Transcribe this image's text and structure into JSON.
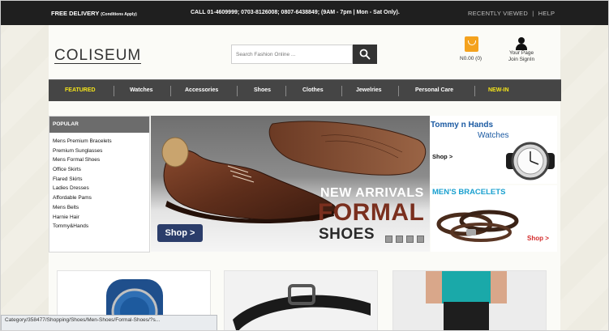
{
  "topbar": {
    "delivery": "FREE DELIVERY",
    "conditions": "(Conditions Apply)",
    "call": "CALL 01-4609999; 0703-8126008; 0807-6438849;  (9AM - 7pm | Mon - Sat Only).",
    "recently_viewed": "RECENTLY VIEWED",
    "separator": "|",
    "help": "HELP"
  },
  "header": {
    "logo": "COLISEUM",
    "search_placeholder": "Search Fashion Online ...",
    "cart_amount": "N0.00 (0)",
    "your_page": "Your Page",
    "join_signin": "Join SignIn"
  },
  "nav": {
    "items": [
      {
        "label": "FEATURED",
        "highlight": true
      },
      {
        "label": "Watches",
        "highlight": false
      },
      {
        "label": "Accessories",
        "highlight": false
      },
      {
        "label": "Shoes",
        "highlight": false
      },
      {
        "label": "Clothes",
        "highlight": false
      },
      {
        "label": "Jewelries",
        "highlight": false
      },
      {
        "label": "Personal Care",
        "highlight": false
      },
      {
        "label": "NEW-IN",
        "highlight": true
      }
    ]
  },
  "popular": {
    "heading": "POPULAR",
    "items": [
      "Mens Premium Bracelets",
      "Premium Sunglasses",
      "Mens Formal Shoes",
      "Office Skirts",
      "Flared Skirts",
      "Ladies Dresses",
      "Affordable Pams",
      "Mens Belts",
      "Harnie Hair",
      "Tommy&Hands"
    ]
  },
  "hero": {
    "new_arrivals": "NEW ARRIVALS",
    "formal": "FORMAL",
    "shoes": "SHOES",
    "shop_button": "Shop >",
    "slide_count": 4
  },
  "promo_watches": {
    "title": "Tommy n Hands",
    "subtitle": "Watches",
    "shop": "Shop >"
  },
  "promo_bracelets": {
    "title": "MEN'S BRACELETS",
    "shop": "Shop >"
  },
  "statusbar": {
    "url": "Category/358477/Shopping/Shoes/Men-Shoes/Formal-Shoes/?s..."
  },
  "colors": {
    "topbar": "#1f1f1f",
    "nav": "#454545",
    "nav_highlight": "#f5e51a",
    "accent_orange": "#f4a21e",
    "shop_button": "#2b3d6a",
    "promo_blue": "#1b5aa2",
    "promo_cyan": "#1aa0cf",
    "promo_red": "#d42c2c",
    "formal_brown": "#7a2f1e"
  },
  "icons": [
    "search-icon",
    "cart-icon",
    "user-icon"
  ]
}
